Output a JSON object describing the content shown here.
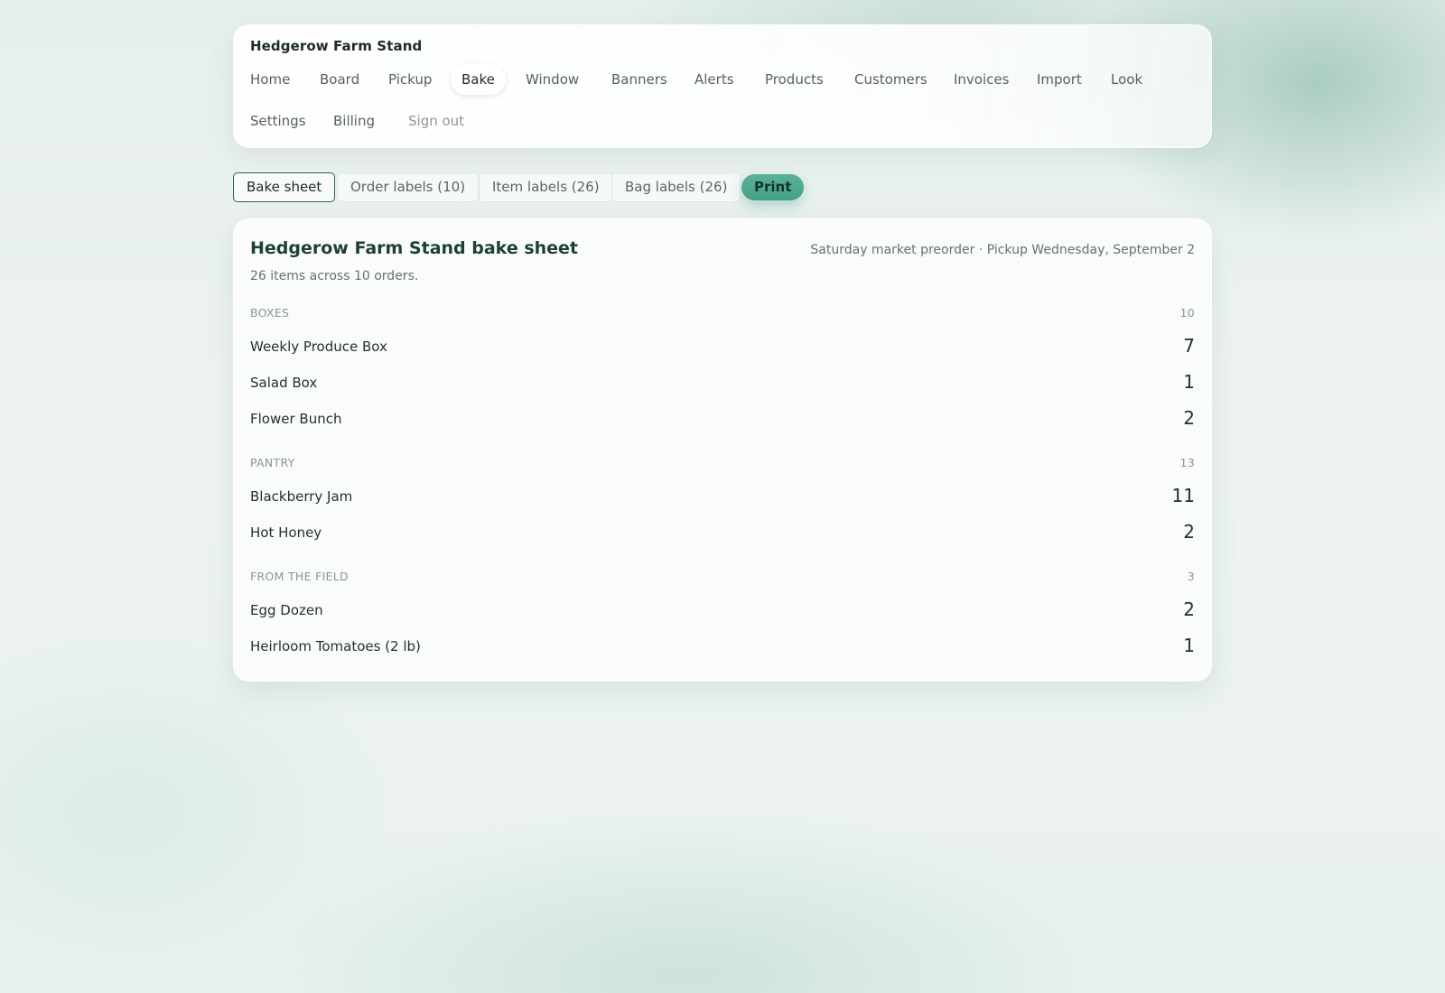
{
  "app": {
    "brand": "Hedgerow Farm Stand"
  },
  "nav": {
    "items": [
      {
        "label": "Home",
        "active": false
      },
      {
        "label": "Board",
        "active": false
      },
      {
        "label": "Pickup",
        "active": false
      },
      {
        "label": "Bake",
        "active": true
      },
      {
        "label": "Window",
        "active": false
      },
      {
        "label": "Banners",
        "active": false
      },
      {
        "label": "Alerts",
        "active": false
      },
      {
        "label": "Products",
        "active": false
      },
      {
        "label": "Customers",
        "active": false
      },
      {
        "label": "Invoices",
        "active": false
      },
      {
        "label": "Import",
        "active": false
      },
      {
        "label": "Look",
        "active": false
      },
      {
        "label": "Settings",
        "active": false
      },
      {
        "label": "Billing",
        "active": false
      }
    ],
    "sign_out": "Sign out"
  },
  "tabs": [
    {
      "label": "Bake sheet",
      "active": true
    },
    {
      "label": "Order labels (10)",
      "active": false
    },
    {
      "label": "Item labels (26)",
      "active": false
    },
    {
      "label": "Bag labels (26)",
      "active": false
    }
  ],
  "print_label": "Print",
  "sheet": {
    "title": "Hedgerow Farm Stand bake sheet",
    "meta": "Saturday market preorder · Pickup Wednesday, September 2",
    "summary": "26 items across 10 orders.",
    "sections": [
      {
        "name": "BOXES",
        "count": "10",
        "items": [
          {
            "name": "Weekly Produce Box",
            "qty": "7"
          },
          {
            "name": "Salad Box",
            "qty": "1"
          },
          {
            "name": "Flower Bunch",
            "qty": "2"
          }
        ]
      },
      {
        "name": "PANTRY",
        "count": "13",
        "items": [
          {
            "name": "Blackberry Jam",
            "qty": "11"
          },
          {
            "name": "Hot Honey",
            "qty": "2"
          }
        ]
      },
      {
        "name": "FROM THE FIELD",
        "count": "3",
        "items": [
          {
            "name": "Egg Dozen",
            "qty": "2"
          },
          {
            "name": "Heirloom Tomatoes (2 lb)",
            "qty": "1"
          }
        ]
      }
    ]
  },
  "colors": {
    "accent": "#44a086",
    "title": "#1e3f37",
    "active_tab_border": "#2f5e52"
  }
}
